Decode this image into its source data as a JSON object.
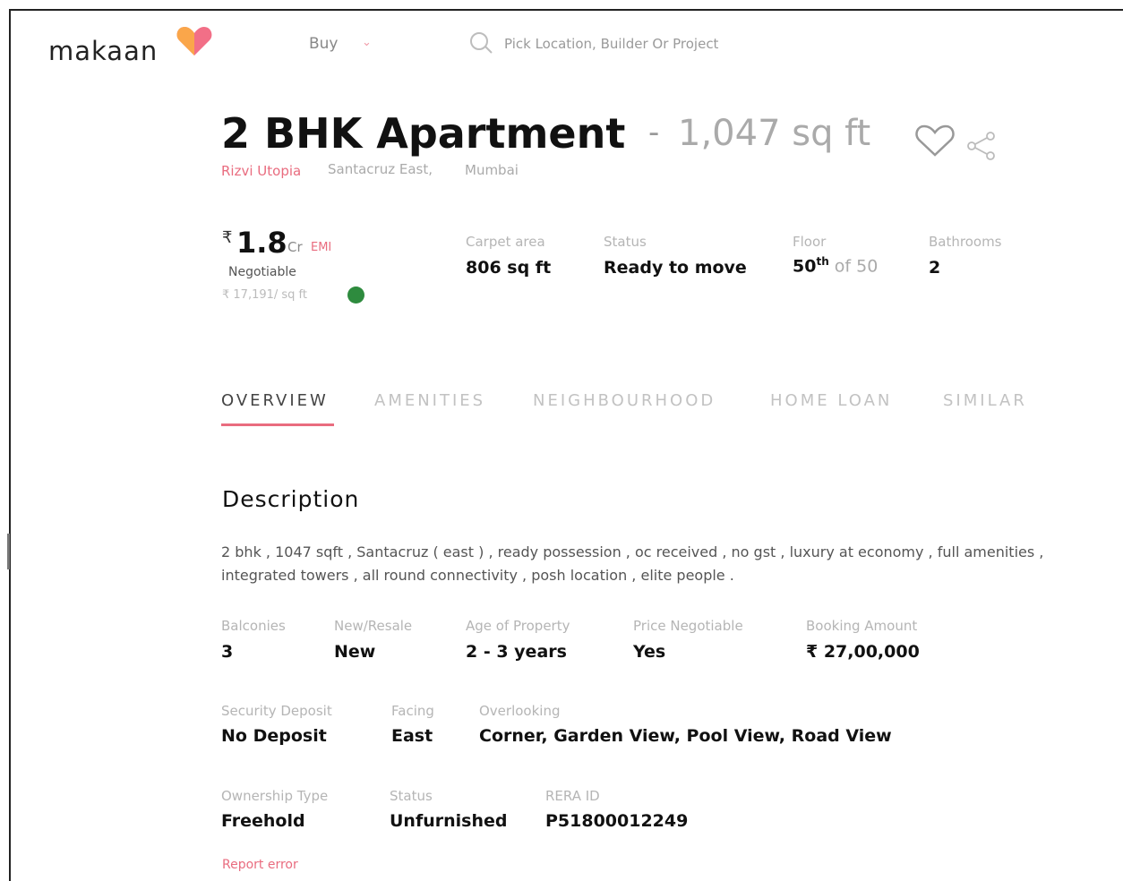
{
  "header": {
    "brand": "makaan",
    "buy_label": "Buy",
    "search_placeholder": "Pick Location, Builder Or Project"
  },
  "listing": {
    "title": "2 BHK Apartment",
    "title_separator": "-",
    "area": "1,047 sq ft",
    "project": "Rizvi Utopia",
    "locality": "Santacruz East,",
    "city": "Mumbai"
  },
  "price": {
    "symbol": "₹",
    "amount": "1.8",
    "unit": "Cr",
    "emi_label": "EMI",
    "negotiable": "Negotiable",
    "per_sqft": "₹ 17,191/ sq ft"
  },
  "summary": [
    {
      "label": "Carpet area",
      "value": "806 sq ft"
    },
    {
      "label": "Status",
      "value": "Ready to move"
    },
    {
      "label": "Floor",
      "value": "50",
      "sup": "th",
      "suffix": " of 50"
    },
    {
      "label": "Bathrooms",
      "value": "2"
    }
  ],
  "tabs": [
    "OVERVIEW",
    "AMENITIES",
    "NEIGHBOURHOOD",
    "HOME LOAN",
    "SIMILAR"
  ],
  "active_tab": "OVERVIEW",
  "description": {
    "heading": "Description",
    "text": "2 bhk , 1047 sqft , Santacruz ( east ) , ready possession , oc received , no gst , luxury at economy , full amenities , integrated towers , all round connectivity , posh location , elite people ."
  },
  "details": [
    {
      "label": "Balconies",
      "value": "3"
    },
    {
      "label": "New/Resale",
      "value": "New"
    },
    {
      "label": "Age of Property",
      "value": "2 - 3 years"
    },
    {
      "label": "Price Negotiable",
      "value": "Yes"
    },
    {
      "label": "Booking Amount",
      "value": "₹ 27,00,000"
    },
    {
      "label": "Security Deposit",
      "value": "No Deposit"
    },
    {
      "label": "Facing",
      "value": "East"
    },
    {
      "label": "Overlooking",
      "value": "Corner, Garden View, Pool View, Road View"
    },
    {
      "label": "Ownership Type",
      "value": "Freehold"
    },
    {
      "label": "Status",
      "value": "Unfurnished"
    },
    {
      "label": "RERA ID",
      "value": "P51800012249"
    }
  ],
  "report_error": "Report error",
  "colors": {
    "accent": "#e96c7f",
    "info_dot": "#2e8b3e",
    "heart_logo": "#f47a8a"
  }
}
